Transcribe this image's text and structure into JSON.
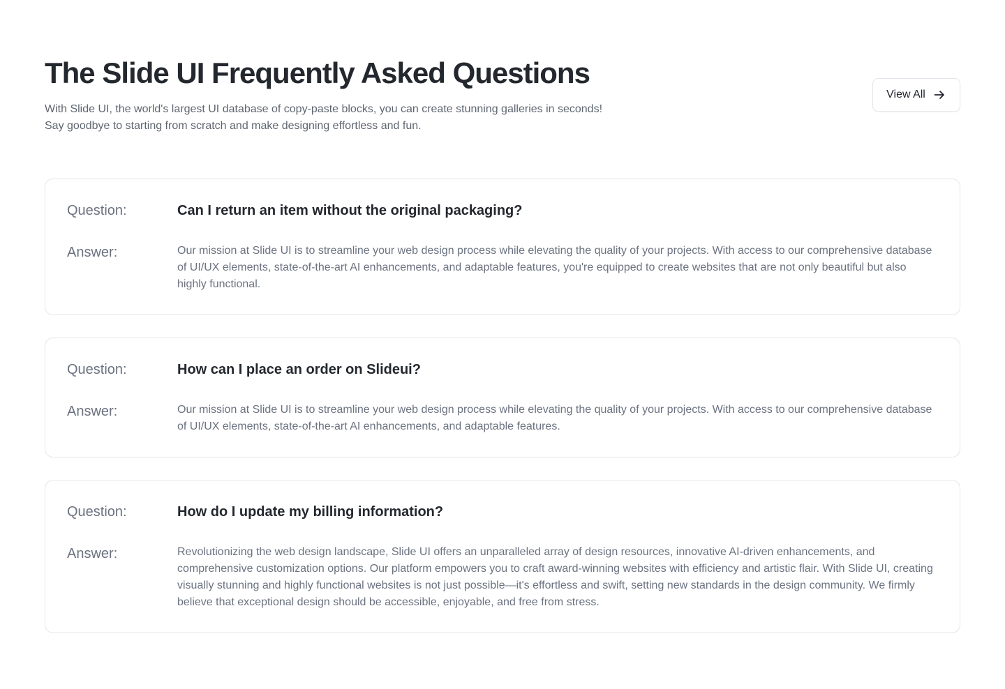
{
  "header": {
    "title": "The Slide UI Frequently Asked Questions",
    "subtitle": "With Slide UI, the world's largest UI database of copy-paste blocks, you can create stunning galleries in seconds! Say goodbye to starting from scratch and make designing effortless and fun.",
    "view_all_label": "View All",
    "view_all_icon": "arrow-right-icon"
  },
  "labels": {
    "question": "Question:",
    "answer": "Answer:"
  },
  "faqs": [
    {
      "question": "Can I return an item without the original packaging?",
      "answer": "Our mission at Slide UI is to streamline your web design process while elevating the quality of your projects. With access to our comprehensive database of UI/UX elements, state-of-the-art AI enhancements, and adaptable features, you're equipped to create websites that are not only beautiful but also highly functional."
    },
    {
      "question": "How can I place an order on Slideui?",
      "answer": "Our mission at Slide UI is to streamline your web design process while elevating the quality of your projects. With access to our comprehensive database of UI/UX elements, state-of-the-art AI enhancements, and adaptable features."
    },
    {
      "question": "How do I update my billing information?",
      "answer": "Revolutionizing the web design landscape, Slide UI offers an unparalleled array of design resources, innovative AI-driven enhancements, and comprehensive customization options. Our platform empowers you to craft award-winning websites with efficiency and artistic flair. With Slide UI, creating visually stunning and highly functional websites is not just possible—it's effortless and swift, setting new standards in the design community. We firmly believe that exceptional design should be accessible, enjoyable, and free from stress."
    }
  ],
  "colors": {
    "text_primary": "#23272e",
    "text_muted": "#6b7280",
    "border": "#e3e6ea",
    "background": "#ffffff"
  }
}
